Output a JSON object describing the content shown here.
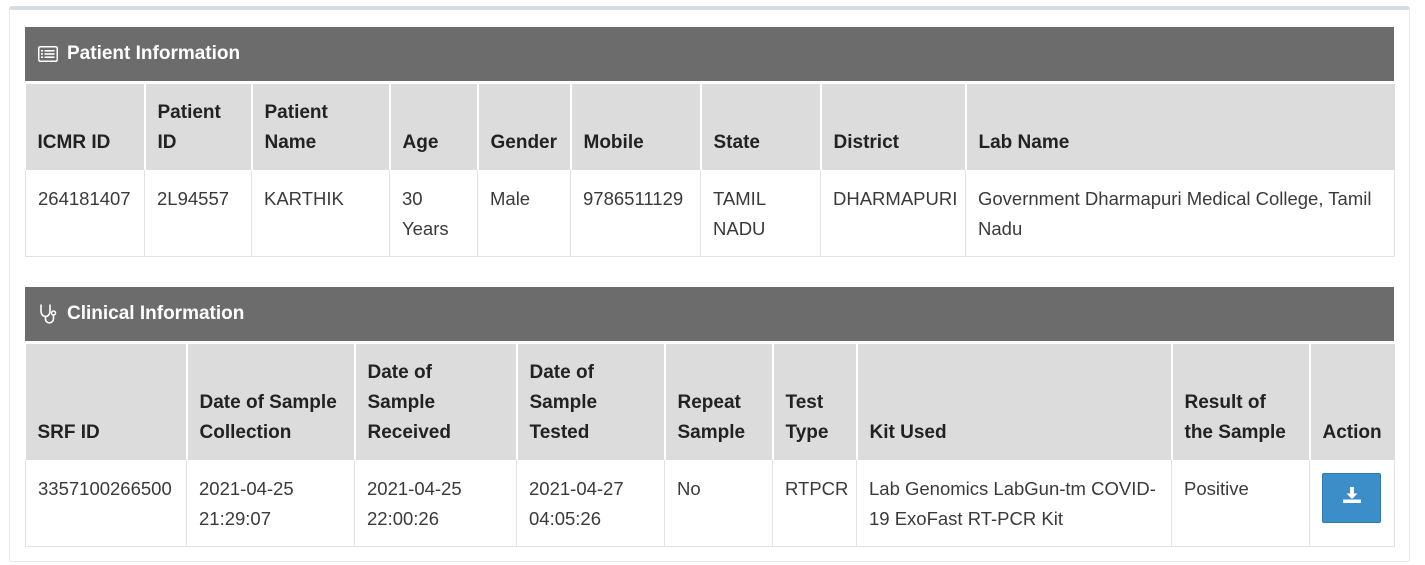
{
  "patient_section": {
    "title": "Patient Information",
    "icon": "list-icon",
    "headers": [
      "ICMR ID",
      "Patient ID",
      "Patient Name",
      "Age",
      "Gender",
      "Mobile",
      "State",
      "District",
      "Lab Name"
    ],
    "row": [
      "264181407",
      "2L94557",
      "KARTHIK",
      "30 Years",
      "Male",
      "9786511129",
      "TAMIL NADU",
      "DHARMAPURI",
      "Government Dharmapuri Medical College, Tamil Nadu"
    ]
  },
  "clinical_section": {
    "title": "Clinical Information",
    "icon": "stethoscope-icon",
    "headers": [
      "SRF ID",
      "Date of Sample Collection",
      "Date of Sample Received",
      "Date of Sample Tested",
      "Repeat Sample",
      "Test Type",
      "Kit Used",
      "Result of the Sample",
      "Action"
    ],
    "row": [
      "3357100266500",
      "2021-04-25 21:29:07",
      "2021-04-25 22:00:26",
      "2021-04-27 04:05:26",
      "No",
      "RTPCR",
      "Lab Genomics LabGun-tm COVID-19 ExoFast RT-PCR Kit",
      "Positive"
    ],
    "action_icon": "download-icon"
  },
  "colors": {
    "panel_header_bg": "#6c6c6c",
    "table_header_bg": "#dcdcdc",
    "button_bg": "#3b8ec8"
  }
}
